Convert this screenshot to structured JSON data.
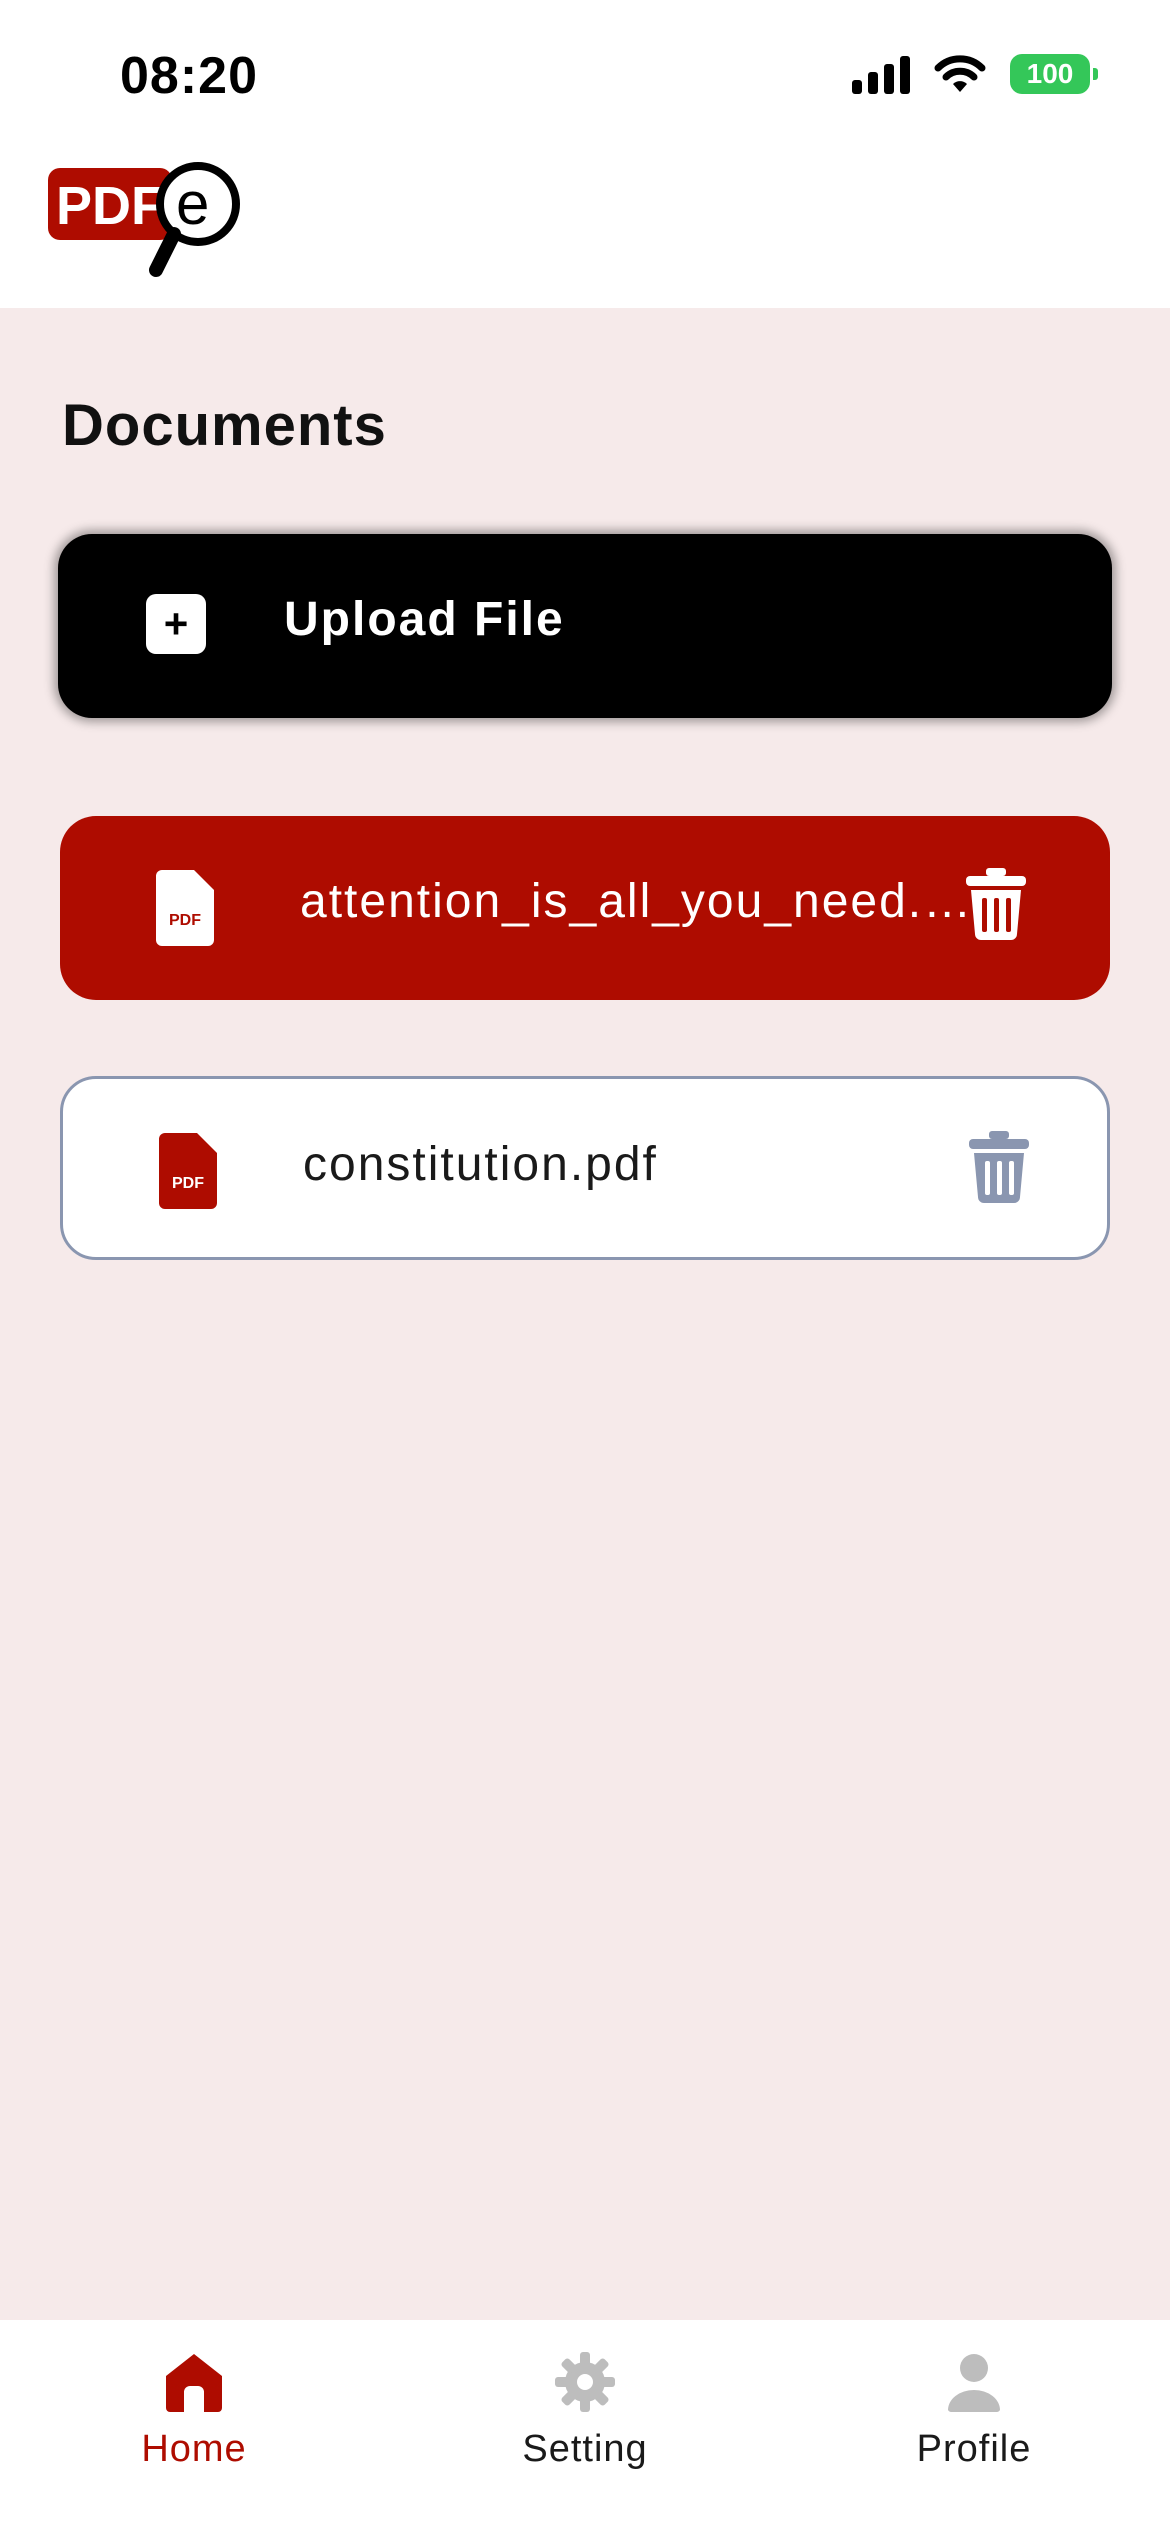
{
  "status_bar": {
    "time": "08:20",
    "battery": "100"
  },
  "header": {
    "logo_text": "PDF",
    "logo_letter": "e"
  },
  "main": {
    "title": "Documents",
    "upload_label": "Upload File",
    "documents": [
      {
        "name": "attention_is_all_you_need.pdf",
        "selected": true
      },
      {
        "name": "constitution.pdf",
        "selected": false
      }
    ]
  },
  "nav": {
    "items": [
      {
        "label": "Home",
        "icon": "home-icon",
        "active": true
      },
      {
        "label": "Setting",
        "icon": "gear-icon",
        "active": false
      },
      {
        "label": "Profile",
        "icon": "user-icon",
        "active": false
      }
    ]
  },
  "colors": {
    "brand_red": "#ae0c00",
    "background": "#f6eaea",
    "inactive_icon": "#8a96b0",
    "battery_green": "#34c759"
  }
}
